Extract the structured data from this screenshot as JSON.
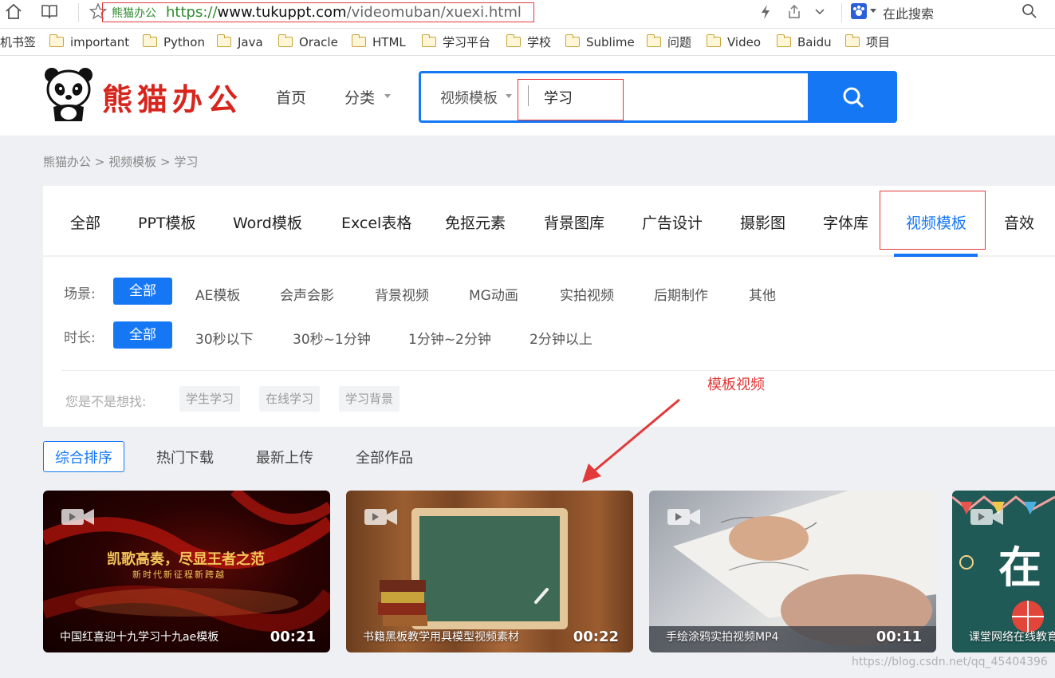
{
  "browser": {
    "site_label": "熊猫办公",
    "url_scheme": "https://",
    "url_host": "www.tukuppt.com",
    "url_path": "/videomuban/xuexi.html",
    "search_engine_placeholder": "在此搜索"
  },
  "bookmarks": {
    "first": "机书签",
    "folders": [
      "important",
      "Python",
      "Java",
      "Oracle",
      "HTML",
      "学习平台",
      "学校",
      "Sublime",
      "问题",
      "Video",
      "Baidu",
      "项目"
    ]
  },
  "site": {
    "logo_text": "熊猫办公",
    "nav_home": "首页",
    "nav_category": "分类",
    "search_type": "视频模板",
    "search_value": "学习"
  },
  "breadcrumb": [
    "熊猫办公",
    "视频模板",
    "学习"
  ],
  "breadcrumb_sep": ">",
  "category_tabs": [
    "全部",
    "PPT模板",
    "Word模板",
    "Excel表格",
    "免抠元素",
    "背景图库",
    "广告设计",
    "摄影图",
    "字体库",
    "视频模板",
    "音效"
  ],
  "active_category": "视频模板",
  "filters": {
    "scene_label": "场景:",
    "scene_items": [
      "全部",
      "AE模板",
      "会声会影",
      "背景视频",
      "MG动画",
      "实拍视频",
      "后期制作",
      "其他"
    ],
    "duration_label": "时长:",
    "duration_items": [
      "全部",
      "30秒以下",
      "30秒~1分钟",
      "1分钟~2分钟",
      "2分钟以上"
    ]
  },
  "suggest": {
    "label": "您是不是想找:",
    "tags": [
      "学生学习",
      "在线学习",
      "学习背景"
    ]
  },
  "annotation": "模板视频",
  "sort_tabs": [
    "综合排序",
    "热门下载",
    "最新上传",
    "全部作品"
  ],
  "cards": [
    {
      "title": "中国红喜迎十九学习十九ae模板",
      "duration": "00:21",
      "overlay_line1": "凯歌高奏，尽显王者之范",
      "overlay_line2": "新时代新征程新跨越"
    },
    {
      "title": "书籍黑板教学用具模型视频素材",
      "duration": "00:22"
    },
    {
      "title": "手绘涂鸦实拍视频MP4",
      "duration": "00:11"
    },
    {
      "title": "课堂网络在线教育",
      "duration": "",
      "overlay_big": "在"
    }
  ],
  "watermark": "https://blog.csdn.net/qq_45404396",
  "colors": {
    "accent": "#1677f5",
    "logo_red": "#d7261e",
    "annotation_red": "#e23a3a"
  }
}
